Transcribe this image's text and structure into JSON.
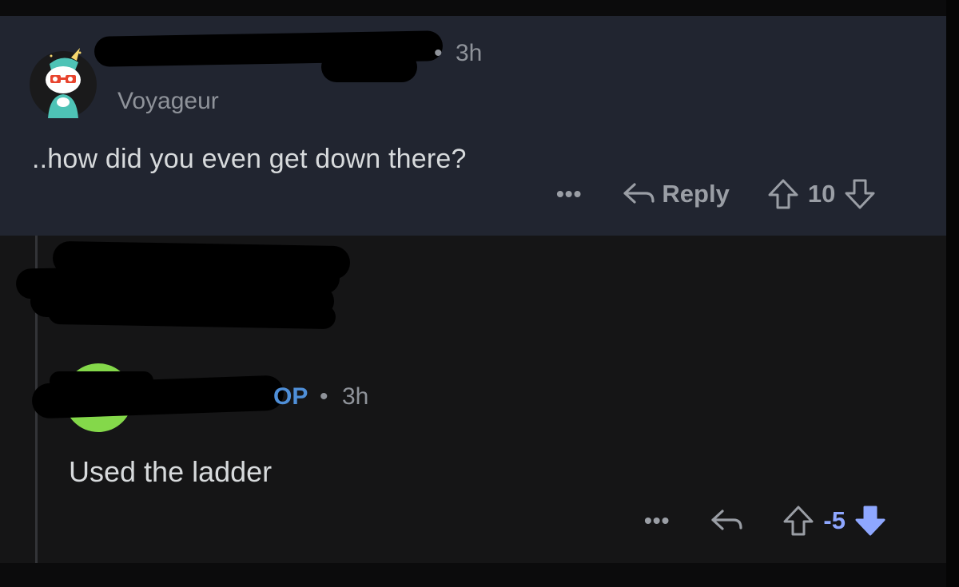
{
  "comment1": {
    "time": "3h",
    "dot": "•",
    "flair": "Voyageur",
    "body": "..how did you even get down there?",
    "more": "•••",
    "reply_label": "Reply",
    "score": "10",
    "avatar_icon": "snoo-unicorn-hat-avatar",
    "reply_icon": "reply-arrow-icon",
    "upvote_icon": "upvote-arrow-icon",
    "downvote_icon": "downvote-arrow-icon"
  },
  "comment2": {
    "op_badge": "OP",
    "dot": "•",
    "time": "3h",
    "body": "Used the ladder",
    "more": "•••",
    "score": "-5",
    "score_color": "#8ea7ff",
    "downvote_active": true
  },
  "colors": {
    "comment_bg_highlight": "#212530",
    "comment_bg": "#151516",
    "op_blue": "#4f8fd8",
    "downvote_blue": "#8ea7ff",
    "avatar_green": "#84d84a"
  }
}
